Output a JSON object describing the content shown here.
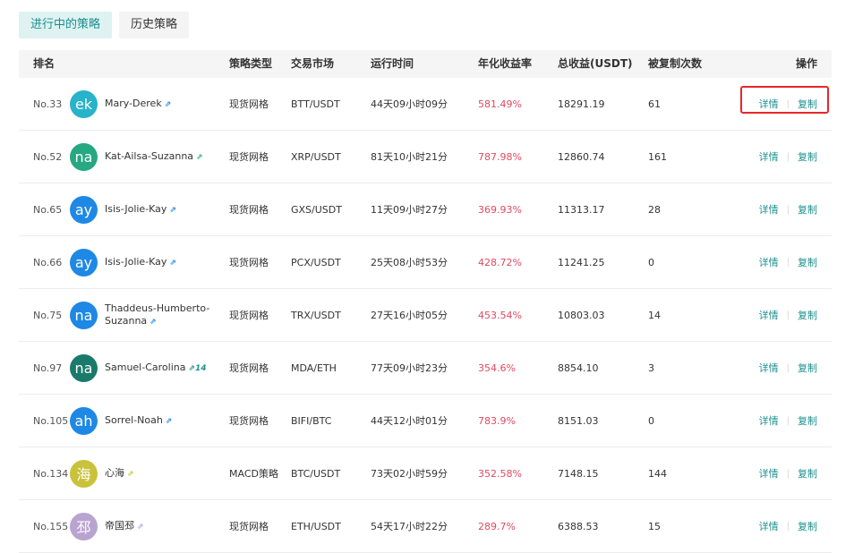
{
  "tabs": [
    {
      "label": "进行中的策略",
      "active": true
    },
    {
      "label": "历史策略",
      "active": false
    }
  ],
  "columns": {
    "rank": "排名",
    "type": "策略类型",
    "market": "交易市场",
    "runtime": "运行时间",
    "annual_rate": "年化收益率",
    "total_profit": "总收益(USDT)",
    "copied": "被复制次数",
    "ops": "操作"
  },
  "ops": {
    "detail": "详情",
    "copy": "复制",
    "separator": "|"
  },
  "colors": {
    "accent": "#1d8f8f",
    "rate": "#e04a62",
    "highlight_border": "#e8262b"
  },
  "rows": [
    {
      "rank": "No.33",
      "avatar_text": "ek",
      "avatar_color": "#27b3c9",
      "name": "Mary-Derek",
      "badge": "⇗",
      "badge_color": "#1e88e5",
      "type": "现货网格",
      "market": "BTT/USDT",
      "runtime": "44天09小时09分",
      "rate": "581.49%",
      "profit": "18291.19",
      "copies": "61"
    },
    {
      "rank": "No.52",
      "avatar_text": "na",
      "avatar_color": "#26a882",
      "name": "Kat-Ailsa-Suzanna",
      "badge": "⇗",
      "badge_color": "#26a882",
      "type": "现货网格",
      "market": "XRP/USDT",
      "runtime": "81天10小时21分",
      "rate": "787.98%",
      "profit": "12860.74",
      "copies": "161"
    },
    {
      "rank": "No.65",
      "avatar_text": "ay",
      "avatar_color": "#1e88e5",
      "name": "Isis-Jolie-Kay",
      "badge": "⇗",
      "badge_color": "#1e88e5",
      "type": "现货网格",
      "market": "GXS/USDT",
      "runtime": "11天09小时27分",
      "rate": "369.93%",
      "profit": "11313.17",
      "copies": "28"
    },
    {
      "rank": "No.66",
      "avatar_text": "ay",
      "avatar_color": "#1e88e5",
      "name": "Isis-Jolie-Kay",
      "badge": "⇗",
      "badge_color": "#1e88e5",
      "type": "现货网格",
      "market": "PCX/USDT",
      "runtime": "25天08小时53分",
      "rate": "428.72%",
      "profit": "11241.25",
      "copies": "0"
    },
    {
      "rank": "No.75",
      "avatar_text": "na",
      "avatar_color": "#1e88e5",
      "name": "Thaddeus-Humberto-Suzanna",
      "name_line1": "Thaddeus-Humberto-",
      "name_line2": "Suzanna",
      "badge": "⇗",
      "badge_color": "#1e88e5",
      "type": "现货网格",
      "market": "TRX/USDT",
      "runtime": "27天16小时05分",
      "rate": "453.54%",
      "profit": "10803.03",
      "copies": "14"
    },
    {
      "rank": "No.97",
      "avatar_text": "na",
      "avatar_color": "#1a7a6a",
      "name": "Samuel-Carolina",
      "badge": "⇗14",
      "badge_color": "#1d8f8f",
      "type": "现货网格",
      "market": "MDA/ETH",
      "runtime": "77天09小时23分",
      "rate": "354.6%",
      "profit": "8854.10",
      "copies": "3"
    },
    {
      "rank": "No.105",
      "avatar_text": "ah",
      "avatar_color": "#1e88e5",
      "name": "Sorrel-Noah",
      "badge": "⇗",
      "badge_color": "#1e88e5",
      "type": "现货网格",
      "market": "BIFI/BTC",
      "runtime": "44天12小时01分",
      "rate": "783.9%",
      "profit": "8151.03",
      "copies": "0"
    },
    {
      "rank": "No.134",
      "avatar_text": "海",
      "avatar_color": "#c9c23a",
      "name": "心海",
      "badge": "⇗",
      "badge_color": "#c9c23a",
      "type": "MACD策略",
      "market": "BTC/USDT",
      "runtime": "73天02小时59分",
      "rate": "352.58%",
      "profit": "7148.15",
      "copies": "144"
    },
    {
      "rank": "No.155",
      "avatar_text": "邳",
      "avatar_color": "#b9a3cf",
      "name": "帝国邳",
      "badge": "⇗",
      "badge_color": "#b9a3cf",
      "type": "现货网格",
      "market": "ETH/USDT",
      "runtime": "54天17小时22分",
      "rate": "289.7%",
      "profit": "6388.53",
      "copies": "15"
    }
  ]
}
